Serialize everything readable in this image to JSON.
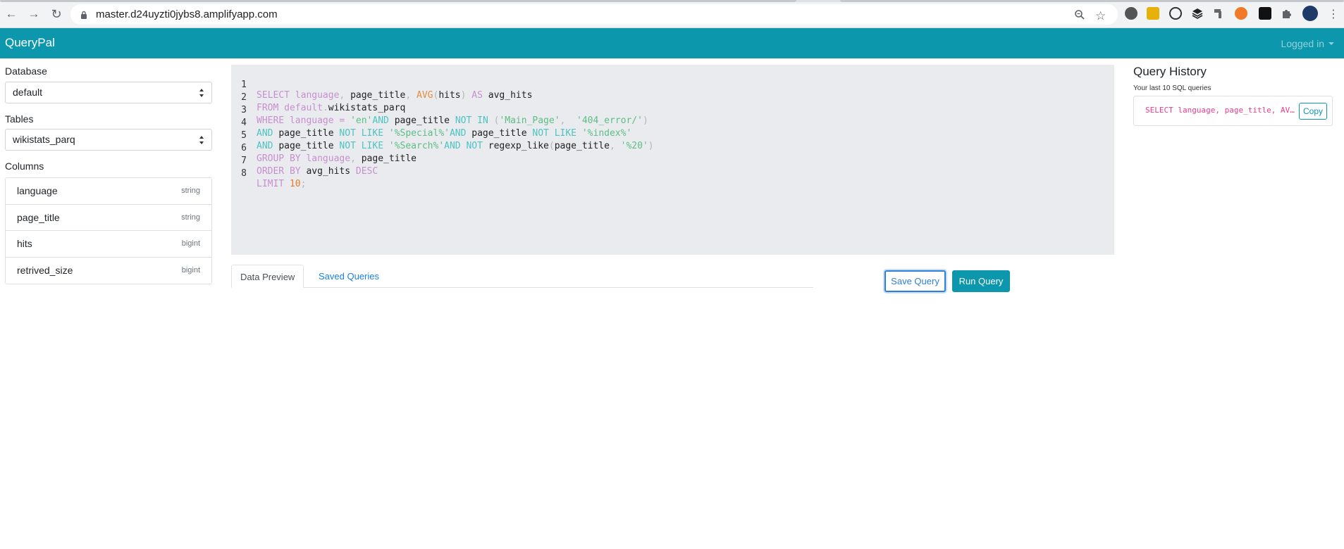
{
  "browser": {
    "url": "master.d24uyzti0jybs8.amplifyapp.com"
  },
  "navbar": {
    "brand": "QueryPal",
    "user_menu": "Logged in"
  },
  "sidebar": {
    "database_label": "Database",
    "database_value": "default",
    "tables_label": "Tables",
    "tables_value": "wikistats_parq",
    "columns_label": "Columns",
    "columns": [
      {
        "name": "language",
        "type": "string"
      },
      {
        "name": "page_title",
        "type": "string"
      },
      {
        "name": "hits",
        "type": "bigint"
      },
      {
        "name": "retrived_size",
        "type": "bigint"
      }
    ]
  },
  "editor": {
    "line_numbers": [
      "1",
      "2",
      "3",
      "4",
      "5",
      "6",
      "7",
      "8"
    ]
  },
  "tabs": {
    "data_preview": "Data Preview",
    "saved_queries": "Saved Queries"
  },
  "actions": {
    "save_query": "Save Query",
    "run_query": "Run Query"
  },
  "history": {
    "title": "Query History",
    "subtitle": "Your last 10 SQL queries",
    "items": [
      {
        "query": "SELECT language, page_title, AVG(hits) AS avg_hits",
        "copy_label": "Copy"
      }
    ]
  },
  "colors": {
    "accent": "#0c97ad",
    "link": "#1a7fe0",
    "history_query": "#e83e8c"
  }
}
